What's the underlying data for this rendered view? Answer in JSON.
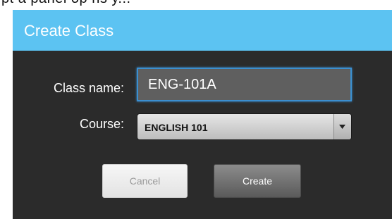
{
  "background_text": "pt a panel op ns y...",
  "dialog": {
    "title": "Create Class",
    "fields": {
      "class_name": {
        "label": "Class name:",
        "value": "ENG-101A"
      },
      "course": {
        "label": "Course:",
        "selected": "ENGLISH 101"
      }
    },
    "buttons": {
      "cancel": "Cancel",
      "create": "Create"
    }
  },
  "colors": {
    "header": "#5cc3f2",
    "dialog_background": "#2b2b2b",
    "input_background": "#5f5f5f",
    "focus_border": "#3b8fd0"
  },
  "icons": {
    "dropdown": "chevron-down-icon"
  }
}
